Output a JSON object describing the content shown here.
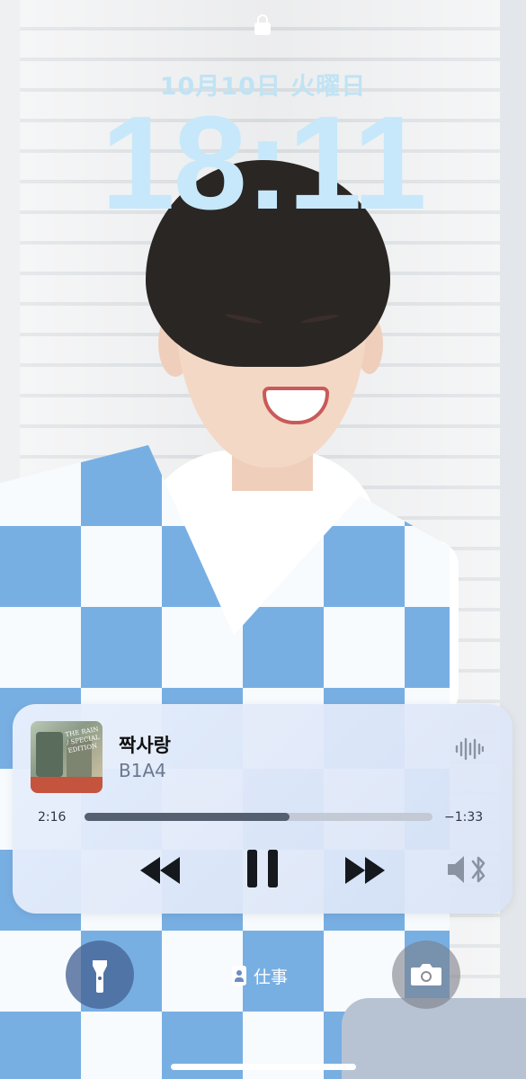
{
  "status": {
    "date": "10月10日 火曜日",
    "time": "18:11",
    "lock_icon": "lock-icon"
  },
  "now_playing": {
    "title": "짝사랑",
    "artist": "B1A4",
    "album_art_text": "THE RAIN / SPECIAL EDITION",
    "elapsed": "2:16",
    "remaining": "−1:33",
    "progress": 0.59,
    "icons": {
      "waveform": "audio-waveform-icon",
      "rewind": "rewind-icon",
      "pause": "pause-icon",
      "forward": "fast-forward-icon",
      "output": "speaker-bluetooth-icon"
    }
  },
  "bottom": {
    "focus_label": "仕事",
    "flashlight_icon": "flashlight-icon",
    "camera_icon": "camera-icon"
  },
  "colors": {
    "clock": "#c6e8fa",
    "accent_blue": "#6aa6e0",
    "progress_fill": "#54606f"
  }
}
